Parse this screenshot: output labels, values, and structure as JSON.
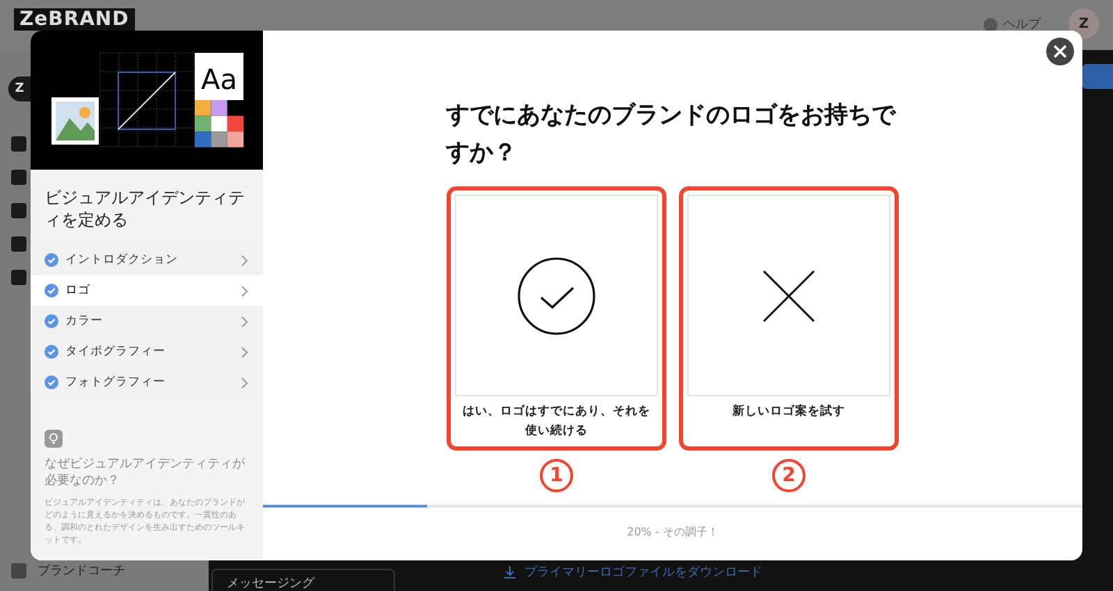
{
  "background_page": {
    "logo": "ZeBRAND",
    "help": "ヘルプ",
    "avatar": "Z",
    "workspace_avatar": "Z",
    "brand_coach": "ブランドコーチ",
    "messaging": "メッセージング",
    "download_link": "プライマリーロゴファイルをダウンロード"
  },
  "modal": {
    "illustration": {
      "type_sample": "Aa"
    },
    "sidebar": {
      "title": "ビジュアルアイデンティティを定める",
      "items": [
        {
          "label": "イントロダクション",
          "checked": true,
          "selected": false
        },
        {
          "label": "ロゴ",
          "checked": true,
          "selected": true
        },
        {
          "label": "カラー",
          "checked": true,
          "selected": false
        },
        {
          "label": "タイポグラフィー",
          "checked": true,
          "selected": false
        },
        {
          "label": "フォトグラフィー",
          "checked": true,
          "selected": false
        }
      ],
      "tip_title": "なぜビジュアルアイデンティティが必要なのか？",
      "tip_text": "ビジュアルアイデンティティは、あなたのブランドがどのように見えるかを決めるものです。一貫性のある、調和のとれたデザインを生み出すためのツールキットです。"
    },
    "question": "すでにあなたのブランドのロゴをお持ちですか？",
    "options": [
      {
        "kind": "check",
        "label": "はい、ロゴはすでにあり、それを使い続ける",
        "highlighted": true,
        "marker": "1"
      },
      {
        "kind": "cross",
        "label": "新しいロゴ案を試す",
        "highlighted": true,
        "marker": "2"
      }
    ],
    "progress": {
      "level": 0.2,
      "text": "20% - その調子！"
    }
  }
}
